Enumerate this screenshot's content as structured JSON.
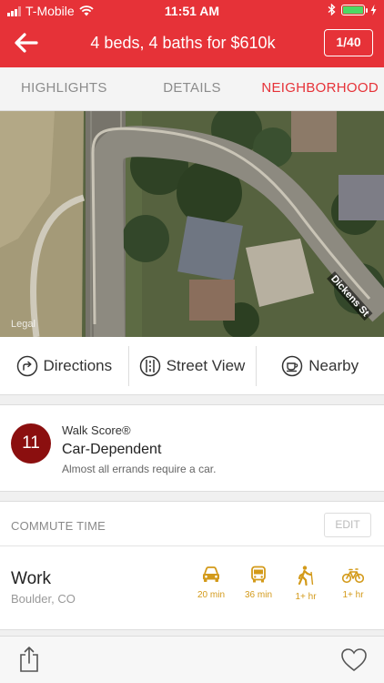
{
  "status_bar": {
    "carrier": "T-Mobile",
    "time": "11:51 AM"
  },
  "header": {
    "title": "4 beds, 4 baths for $610k",
    "counter": "1/40"
  },
  "tabs": [
    {
      "label": "HIGHLIGHTS",
      "active": false
    },
    {
      "label": "DETAILS",
      "active": false
    },
    {
      "label": "NEIGHBORHOOD",
      "active": true
    }
  ],
  "map": {
    "street_label": "Dickens St",
    "legal": "Legal"
  },
  "actions": {
    "directions": "Directions",
    "street_view": "Street View",
    "nearby": "Nearby"
  },
  "walk_score": {
    "score": "11",
    "label": "Walk Score®",
    "status": "Car-Dependent",
    "description": "Almost all errands require a car."
  },
  "commute": {
    "heading": "COMMUTE TIME",
    "edit_label": "EDIT",
    "destination": "Work",
    "location": "Boulder, CO",
    "modes": [
      {
        "icon": "car-icon",
        "time": "20 min"
      },
      {
        "icon": "bus-icon",
        "time": "36 min"
      },
      {
        "icon": "walk-icon",
        "time": "1+ hr"
      },
      {
        "icon": "bike-icon",
        "time": "1+ hr"
      }
    ]
  },
  "colors": {
    "brand": "#e63238",
    "walk_score_circle": "#8b0f0f",
    "commute_icon": "#d39a1a"
  }
}
